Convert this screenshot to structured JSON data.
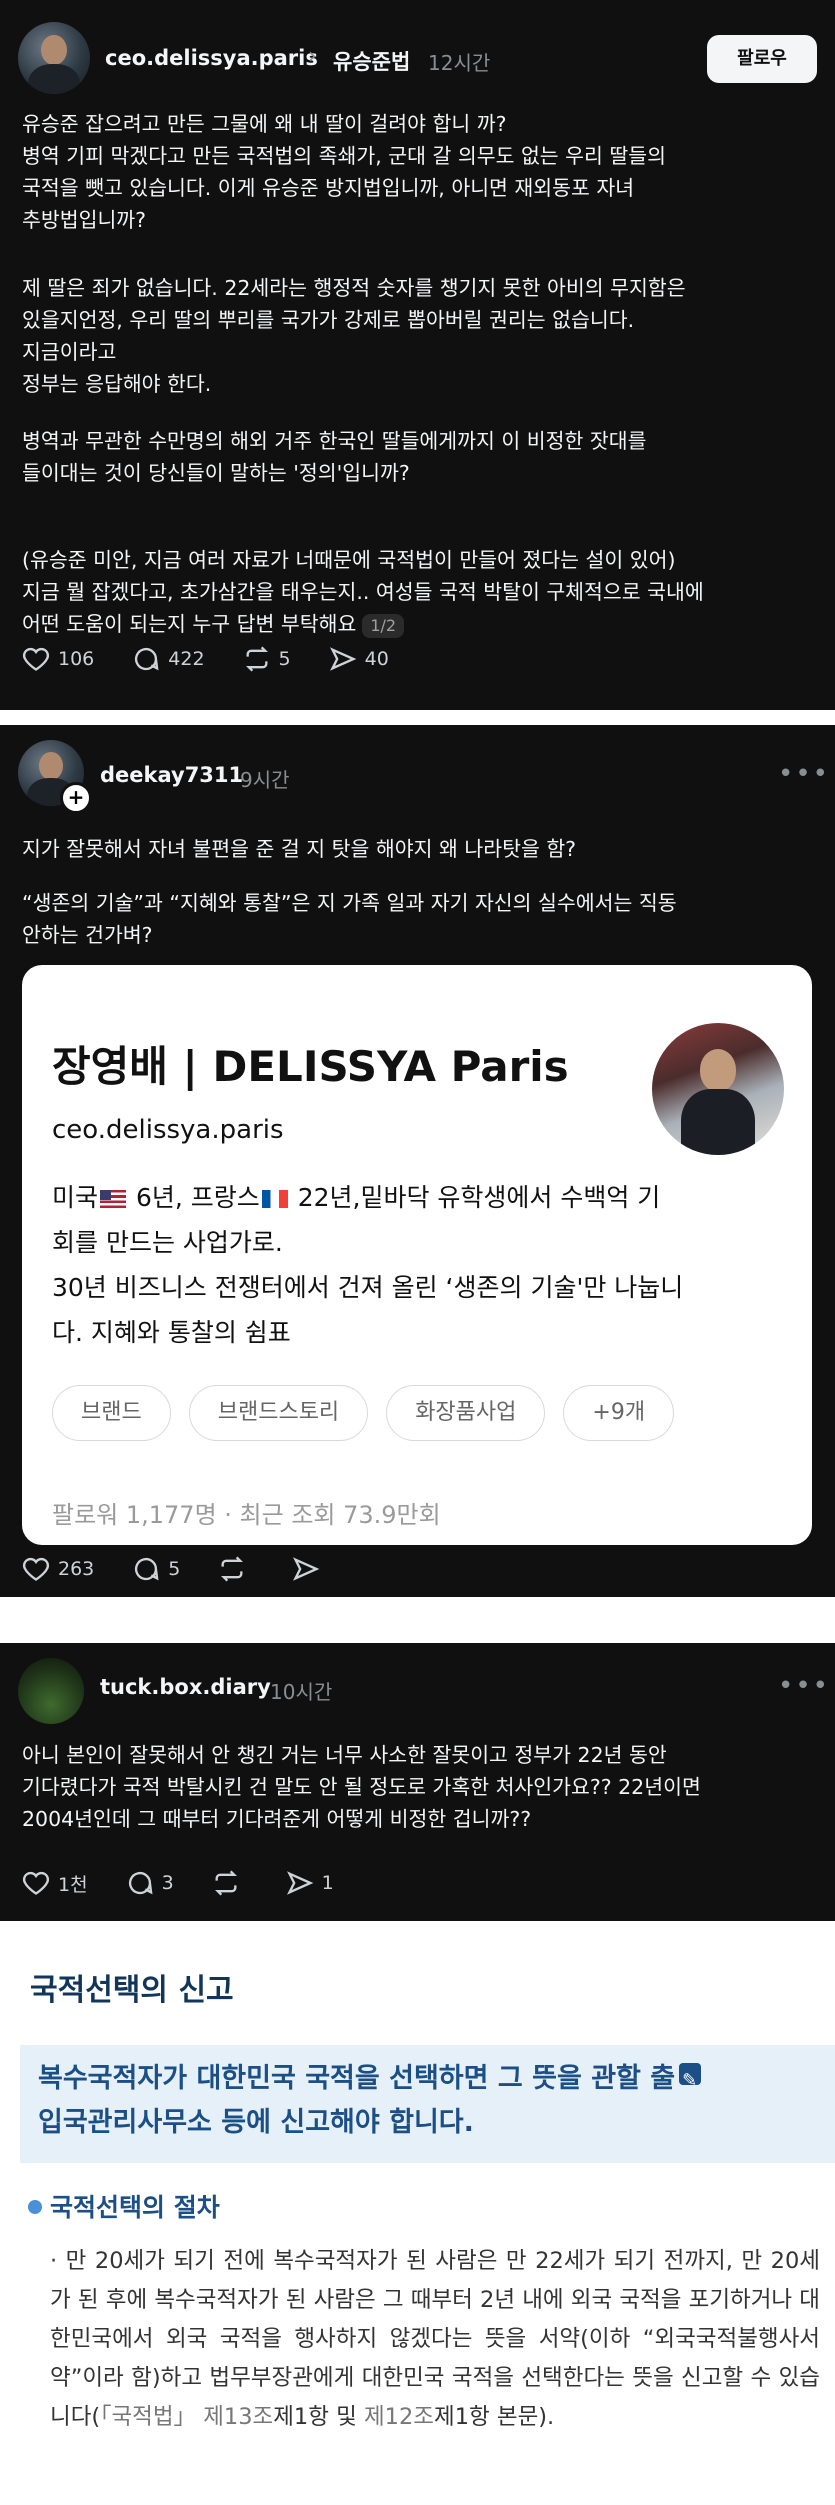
{
  "post1": {
    "username": "ceo.delissya.paris",
    "topic": "유승준법",
    "time": "12시간",
    "follow_label": "팔로우",
    "paragraphs": [
      "유승준 잡으려고 만든 그물에 왜 내 딸이 걸려야 합니 까?\n병역 기피 막겠다고 만든 국적법의 족쇄가, 군대 갈 의무도 없는 우리 딸들의\n국적을 뺏고 있습니다. 이게 유승준 방지법입니까, 아니면 재외동포 자녀\n추방법입니까?",
      "제 딸은 죄가 없습니다. 22세라는 행정적 숫자를 챙기지 못한 아비의 무지함은\n있을지언정, 우리 딸의 뿌리를 국가가 강제로 뽑아버릴 권리는 없습니다.\n지금이라고\n정부는 응답해야 한다.",
      "병역과 무관한 수만명의 해외 거주 한국인 딸들에게까지 이 비정한 잣대를\n들이대는 것이 당신들이 말하는 '정의'입니까?",
      "(유승준 미안, 지금 여러 자료가 너때문에 국적법이 만들어 졌다는 설이 있어)\n지금 뭘 잡겠다고, 초가삼간을 태우는지.. 여성들 국적 박탈이 구체적으로 국내에\n어떤 도움이 되는지 누구 답변 부탁해요"
    ],
    "pager": "1/2",
    "likes": "106",
    "comments": "422",
    "reposts": "5",
    "shares": "40"
  },
  "post2": {
    "username": "deekay7311",
    "time": "9시간",
    "more": "•••",
    "paragraphs": [
      "지가 잘못해서 자녀 불편을 준 걸 지 탓을 해야지 왜 나라탓을 함?",
      "“생존의 기술”과 “지혜와 통찰”은 지 가족 일과 자기 자신의 실수에서는 직동\n안하는 건가벼?"
    ],
    "card": {
      "name": "장영배 | DELISSYA Paris",
      "handle": "ceo.delissya.paris",
      "bio_line1_a": "미국",
      "bio_line1_b": " 6년, 프랑스",
      "bio_line1_c": " 22년,밑바닥 유학생에서 수백억 기",
      "bio_rest": "회를 만드는 사업가로.\n30년 비즈니스 전쟁터에서 건져 올린 ‘생존의 기술'만 나눕니\n다. 지혜와 통찰의 쉼표",
      "chips": [
        "브랜드",
        "브랜드스토리",
        "화장품사업",
        "+9개"
      ],
      "stats": "팔로워 1,177명 · 최근 조회 73.9만회"
    },
    "likes": "263",
    "comments": "5"
  },
  "post3": {
    "username": "tuck.box.diary",
    "time": "10시간",
    "more": "•••",
    "paragraphs": [
      "아니 본인이 잘못해서 안 챙긴 거는 너무 사소한 잘못이고 정부가 22년 동안\n기다렸다가 국적 박탈시킨 건 말도 안 될 정도로 가혹한 처사인가요?? 22년이면\n2004년인데 그 때부터 기다려준게 어떻게 비정한 겁니까??"
    ],
    "likes": "1천",
    "comments": "3",
    "shares": "1"
  },
  "doc": {
    "title": "국적선택의 신고",
    "highlight": "복수국적자가 대한민국 국적을 선택하면 그 뜻을 관할 출",
    "highlight2": "입국관리사무소 등에 신고해야 합니다.",
    "subtitle": "국적선택의 절차",
    "body_a": "· 만 20세가 되기 전에 복수국적자가 된 사람은 만 22세가 되기 전까지, 만 20세가 된 후에 복수국적자가 된 사람은 그 때부터 2년 내에 외국 국적을 포기하거나 대한민국에서 외국 국적을 행사하지 않겠다는 뜻을 서약(이하 “외국국적불행사서약”이라 함)하고 법무부장관에게 대한민국 국적을 선택한다는 뜻을 신고할 수 있습니다(",
    "body_b": "「국적법」 제13조",
    "body_c": "제1항 및 ",
    "body_d": "제12조",
    "body_e": "제1항 본문)."
  }
}
